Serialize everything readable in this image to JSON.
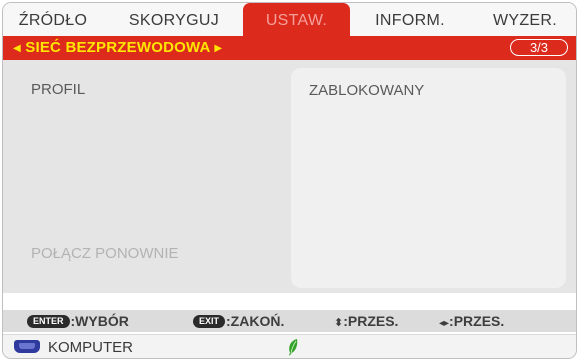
{
  "menu": {
    "tabs": [
      {
        "label": "ŹRÓDŁO",
        "active": false
      },
      {
        "label": "SKORYGUJ",
        "active": false
      },
      {
        "label": "USTAW.",
        "active": true
      },
      {
        "label": "INFORM.",
        "active": false
      },
      {
        "label": "WYZER.",
        "active": false
      }
    ],
    "submenu_title": "SIEĆ BEZPRZEWODOWA",
    "page_indicator": "3/3"
  },
  "settings": {
    "profile_label": "PROFIL",
    "reconnect_label": "POŁĄCZ PONOWNIE",
    "profile_value": "ZABLOKOWANY"
  },
  "help_bar": {
    "enter_key": "ENTER",
    "enter_action": ":WYBÓR",
    "exit_key": "EXIT",
    "exit_action": ":ZAKOŃ.",
    "updown_action": ":PRZES.",
    "leftright_action": ":PRZES."
  },
  "source_bar": {
    "source_label": "KOMPUTER",
    "source_icon": "vga-connector-icon",
    "eco_icon": "eco-leaf-icon"
  },
  "colors": {
    "accent_red": "#dc2a1d",
    "title_yellow": "#ffe600",
    "eco_green": "#34a12c"
  }
}
